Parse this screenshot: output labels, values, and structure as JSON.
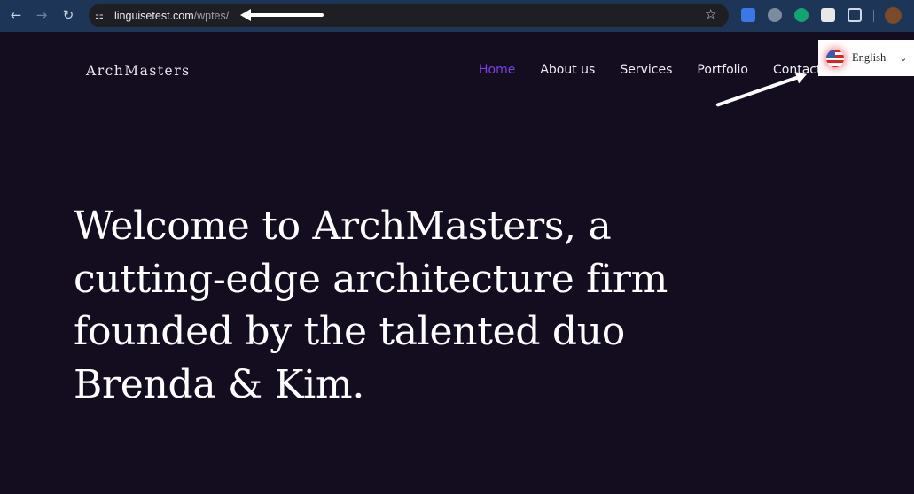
{
  "browser": {
    "url_host": "linguisetest.com",
    "url_path": "/wptes/",
    "icons": [
      "back-icon",
      "forward-icon",
      "reload-icon",
      "site-settings-icon",
      "bookmark-star-icon",
      "google-translate-icon",
      "extension-download-icon",
      "grammarly-icon",
      "qr-code-icon",
      "extensions-puzzle-icon",
      "profile-avatar"
    ]
  },
  "site": {
    "logo": "ArchMasters",
    "nav": [
      {
        "label": "Home",
        "active": true
      },
      {
        "label": "About us"
      },
      {
        "label": "Services"
      },
      {
        "label": "Portfolio"
      },
      {
        "label": "Contact"
      }
    ],
    "accent": "#7b3fe4"
  },
  "language": {
    "selected": "English",
    "flag": "us-flag-icon"
  },
  "hero": {
    "heading": "Welcome to ArchMasters, a cutting-edge architecture firm founded by the talented duo Brenda & Kim."
  }
}
